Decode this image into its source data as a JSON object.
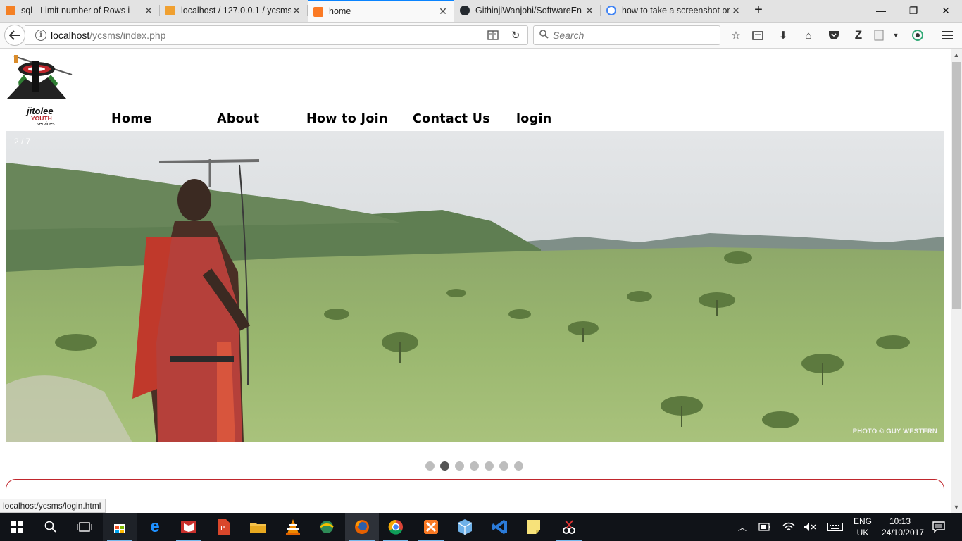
{
  "browser": {
    "tabs": [
      {
        "label": "sql - Limit number of Rows i",
        "fav_color": "#f48024",
        "active": false
      },
      {
        "label": "localhost / 127.0.0.1 / ycsms",
        "fav_color": "#f0a030",
        "active": false
      },
      {
        "label": "home",
        "fav_color": "#fb7a24",
        "active": true
      },
      {
        "label": "GithinjiWanjohi/SoftwareEn",
        "fav_color": "#24292e",
        "active": false
      },
      {
        "label": "how to take a screenshot on",
        "fav_color": "#4285f4",
        "active": false
      }
    ],
    "url_host": "localhost",
    "url_path": "/ycsms/index.php",
    "search_placeholder": "Search",
    "status_url": "localhost/ycsms/login.html"
  },
  "site": {
    "logo": {
      "line1": "jitolee",
      "line2": "YOUTH",
      "line3": "services"
    },
    "nav": [
      "Home",
      "About",
      "How to Join",
      "Contact Us",
      "login"
    ],
    "slider": {
      "counter": "2 / 7",
      "credit": "PHOTO © GUY WESTERN",
      "slide_count": 7,
      "active_index": 1
    }
  },
  "taskbar": {
    "lang_line1": "ENG",
    "lang_line2": "UK",
    "time": "10:13",
    "date": "24/10/2017"
  }
}
